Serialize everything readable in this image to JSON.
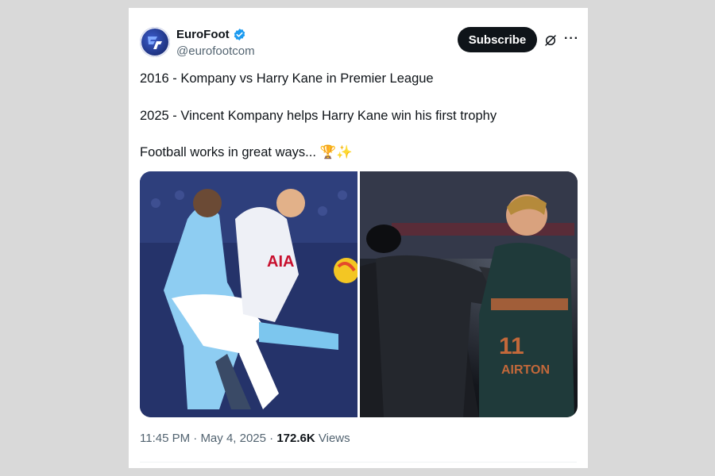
{
  "account": {
    "name": "EuroFoot",
    "handle": "@eurofootcom",
    "verified": true,
    "badge_color": "#1d9bf0"
  },
  "actions": {
    "subscribe_label": "Subscribe",
    "grok_icon": "grok-icon",
    "more_icon": "more-icon",
    "more_label": "···"
  },
  "tweet": {
    "line1": "2016 - Kompany vs Harry Kane in Premier League",
    "line2": "2025 - Vincent Kompany helps Harry Kane win his first trophy",
    "line3": "Football works in great ways... 🏆✨"
  },
  "media": {
    "count": 2
  },
  "meta": {
    "time": "11:45 PM",
    "sep1": " · ",
    "date": "May 4, 2025",
    "sep2": " · ",
    "views_count": "172.6K",
    "views_label": "Views"
  },
  "colors": {
    "text_primary": "#0f1419",
    "text_secondary": "#536471",
    "subscribe_bg": "#0f1419"
  }
}
